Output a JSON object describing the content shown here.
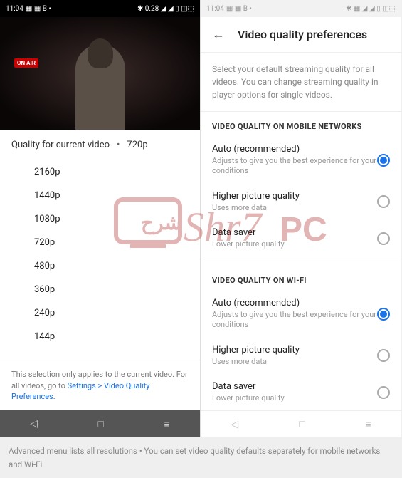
{
  "statusLeft": {
    "time": "11:04",
    "icons": "▦ ▦ B •",
    "right": "✱ 0.28 ◢ ◢ ▯ ◫⬚"
  },
  "statusRight": {
    "time": "11:04",
    "icons": "▦ ▦ B •",
    "right": "✱ ▦ ◢ ◢ ▯ ◫⬚"
  },
  "left": {
    "onair": "ON AIR",
    "header": "Quality for current video",
    "current": "720p",
    "resolutions": [
      "2160p",
      "1440p",
      "1080p",
      "720p",
      "480p",
      "360p",
      "240p",
      "144p"
    ],
    "footer": "This selection only applies to the current video. For all videos, go to ",
    "footerLink": "Settings > Video Quality Preferences."
  },
  "right": {
    "title": "Video quality preferences",
    "desc": "Select your default streaming quality for all videos. You can change streaming quality in player options for single videos.",
    "section1": "VIDEO QUALITY ON MOBILE NETWORKS",
    "section2": "VIDEO QUALITY ON WI-FI",
    "options": [
      {
        "title": "Auto (recommended)",
        "sub": "Adjusts to give you the best experience for your conditions",
        "selected": true
      },
      {
        "title": "Higher picture quality",
        "sub": "Uses more data",
        "selected": false
      },
      {
        "title": "Data saver",
        "sub": "Lower picture quality",
        "selected": false
      }
    ]
  },
  "caption": "Advanced menu lists all resolutions • You can set video quality defaults separately for mobile networks and Wi-Fi"
}
